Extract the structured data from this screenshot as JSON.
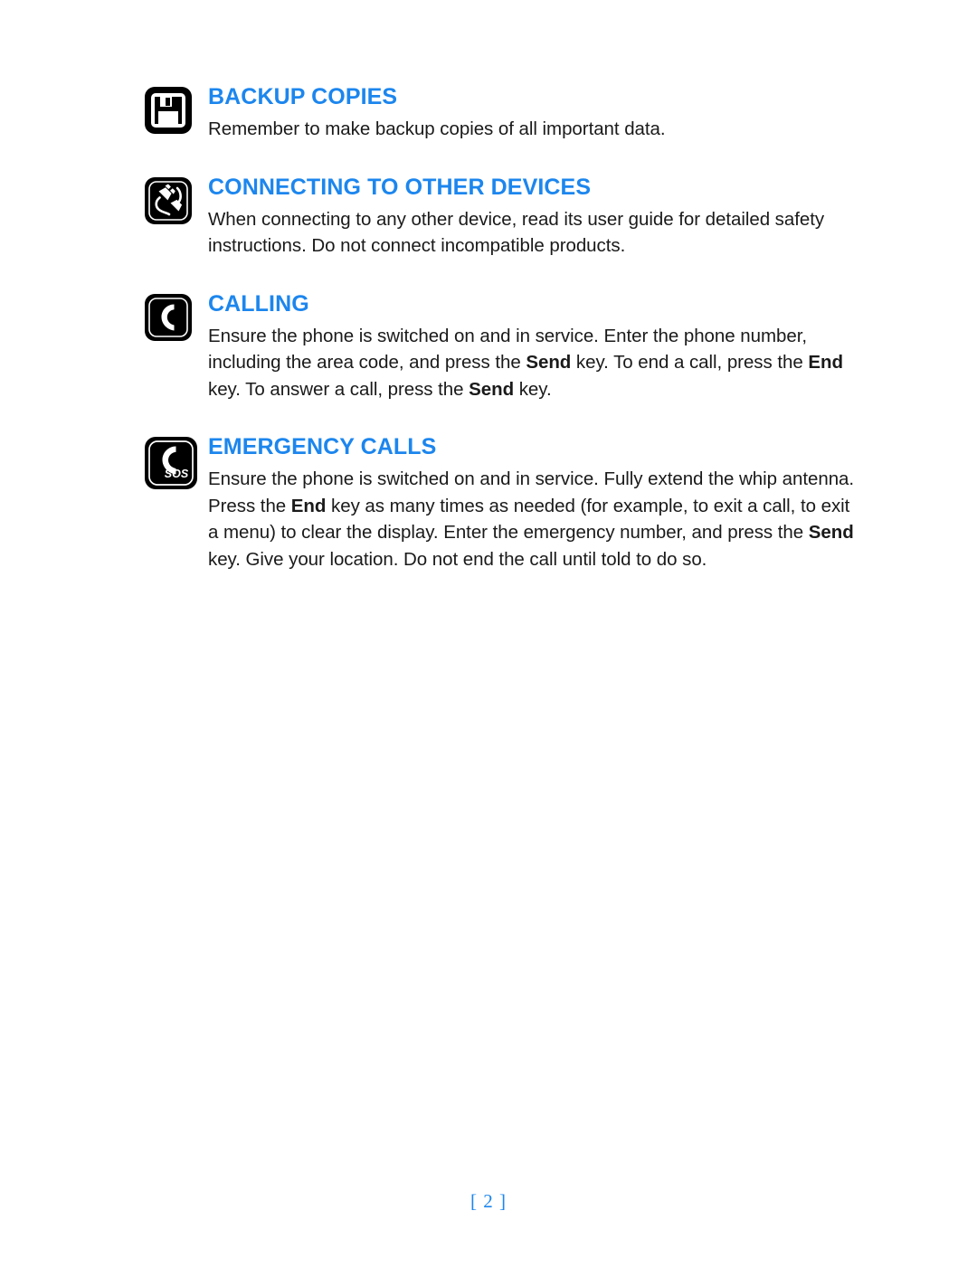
{
  "page": {
    "footer_label": "[ 2 ]",
    "heading_color": "#1c86ee",
    "body_color": "#1a1a1a",
    "background_color": "#ffffff"
  },
  "sections": [
    {
      "icon": "floppy-disk-icon",
      "heading": "BACKUP COPIES",
      "body_parts": [
        {
          "text": "Remember to make backup copies of all important data.",
          "bold": false
        }
      ]
    },
    {
      "icon": "connector-plugs-icon",
      "heading": "CONNECTING TO OTHER DEVICES",
      "body_parts": [
        {
          "text": "When connecting to any other device, read its user guide for detailed safety instructions. Do not connect incompatible products.",
          "bold": false
        }
      ]
    },
    {
      "icon": "phone-handset-icon",
      "heading": "CALLING",
      "body_parts": [
        {
          "text": "Ensure the phone is switched on and in service. Enter the phone number, including the area code, and press the ",
          "bold": false
        },
        {
          "text": "Send",
          "bold": true
        },
        {
          "text": " key. To end a call, press the ",
          "bold": false
        },
        {
          "text": "End",
          "bold": true
        },
        {
          "text": " key. To answer a call, press the ",
          "bold": false
        },
        {
          "text": "Send",
          "bold": true
        },
        {
          "text": " key.",
          "bold": false
        }
      ]
    },
    {
      "icon": "emergency-sos-phone-icon",
      "heading": "EMERGENCY CALLS",
      "body_parts": [
        {
          "text": "Ensure the phone is switched on and in service. Fully extend the whip antenna. Press the ",
          "bold": false
        },
        {
          "text": "End",
          "bold": true
        },
        {
          "text": " key as many times as needed (for example, to exit a call, to exit a menu) to clear the display. Enter the emergency number, and press the ",
          "bold": false
        },
        {
          "text": "Send",
          "bold": true
        },
        {
          "text": " key. Give your location. Do not end the call until told to do so.",
          "bold": false
        }
      ]
    }
  ]
}
